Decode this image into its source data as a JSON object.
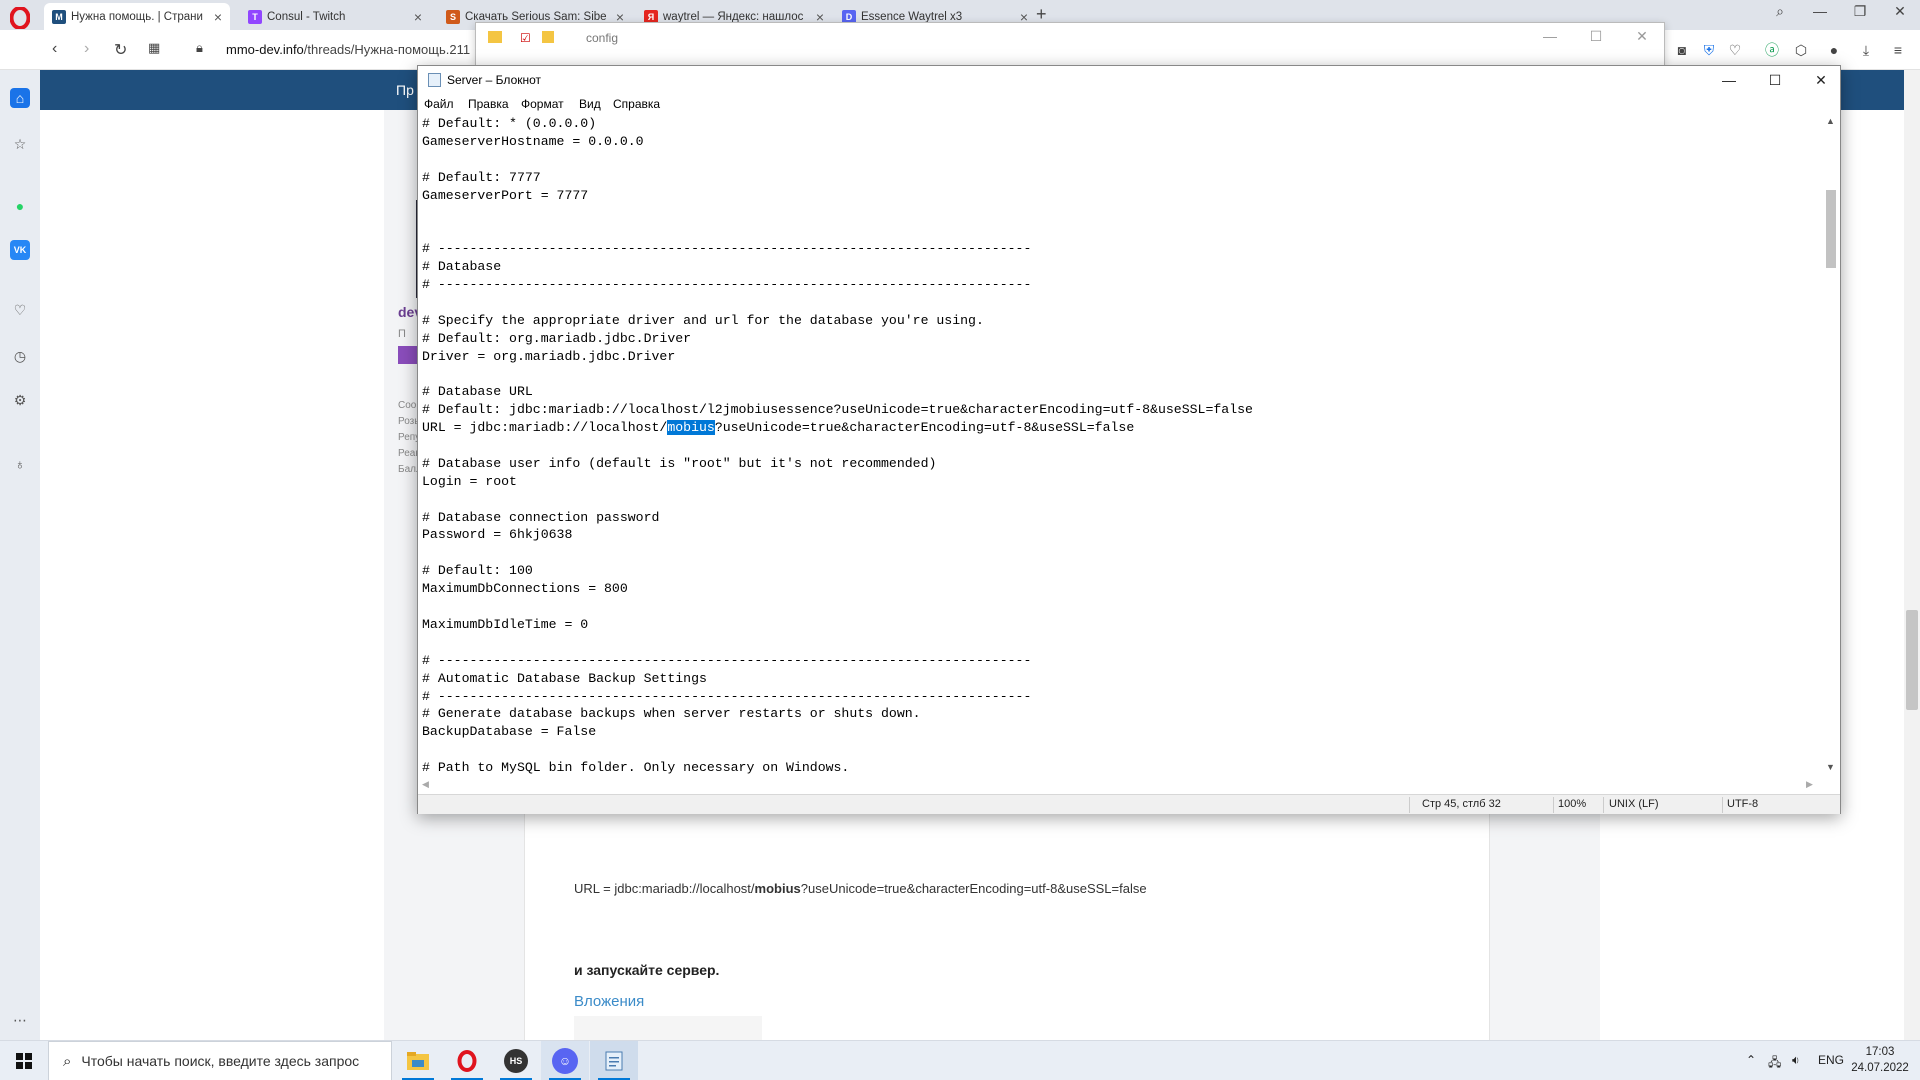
{
  "browser": {
    "tabs": [
      {
        "title": "Нужна помощь. | Страни",
        "icon": "M",
        "icon_color": "#1f4f7d",
        "active": true
      },
      {
        "title": "Consul - Twitch",
        "icon": "T",
        "icon_color": "#9146ff",
        "active": false
      },
      {
        "title": "Скачать Serious Sam: Sibe",
        "icon": "S",
        "icon_color": "#d05a1a",
        "active": false
      },
      {
        "title": "waytrel — Яндекс: нашлос",
        "icon": "Я",
        "icon_color": "#e52620",
        "active": false
      },
      {
        "title": "Essence Waytrel x3",
        "icon": "D",
        "icon_color": "#5865f2",
        "active": false
      }
    ],
    "new_tab": "+",
    "url_host": "mmo-dev.info",
    "url_path": "/threads/Нужна-помощь.211"
  },
  "explorer": {
    "title": "config"
  },
  "webpage": {
    "nav_label": "Пр",
    "user_name": "dev",
    "user_rank": "П",
    "side_labels": [
      "Сооб",
      "Розы",
      "Репу",
      "Реак",
      "Балл"
    ],
    "post_url_prefix": "URL = jdbc:mariadb://localhost/",
    "post_url_bold": "mobius",
    "post_url_suffix": "?useUnicode=true&characterEncoding=utf-8&useSSL=false",
    "post_run_text": "и запускайте сервер.",
    "attachments_label": "Вложения"
  },
  "notepad": {
    "title": "Server – Блокнот",
    "menu": [
      "Файл",
      "Правка",
      "Формат",
      "Вид",
      "Справка"
    ],
    "lines": [
      "# Default: * (0.0.0.0)",
      "GameserverHostname = 0.0.0.0",
      "",
      "# Default: 7777",
      "GameserverPort = 7777",
      "",
      "",
      "# ---------------------------------------------------------------------------",
      "# Database",
      "# ---------------------------------------------------------------------------",
      "",
      "# Specify the appropriate driver and url for the database you're using.",
      "# Default: org.mariadb.jdbc.Driver",
      "Driver = org.mariadb.jdbc.Driver",
      "",
      "# Database URL",
      "# Default: jdbc:mariadb://localhost/l2jmobiusessence?useUnicode=true&characterEncoding=utf-8&useSSL=false",
      "URL = jdbc:mariadb://localhost/mobius?useUnicode=true&characterEncoding=utf-8&useSSL=false",
      "",
      "# Database user info (default is \"root\" but it's not recommended)",
      "Login = root",
      "",
      "# Database connection password",
      "Password = 6hkj0638",
      "",
      "# Default: 100",
      "MaximumDbConnections = 800",
      "",
      "MaximumDbIdleTime = 0",
      "",
      "# ---------------------------------------------------------------------------",
      "# Automatic Database Backup Settings",
      "# ---------------------------------------------------------------------------",
      "# Generate database backups when server restarts or shuts down.",
      "BackupDatabase = False",
      "",
      "# Path to MySQL bin folder. Only necessary on Windows."
    ],
    "selected_word": "mobius",
    "selected_line_index": 17,
    "status": {
      "position": "Стр 45, стлб 32",
      "zoom": "100%",
      "line_ending": "UNIX (LF)",
      "encoding": "UTF-8"
    }
  },
  "taskbar": {
    "search_placeholder": "Чтобы начать поиск, введите здесь запрос",
    "apps": [
      "file-explorer",
      "opera",
      "hs",
      "discord",
      "notepad"
    ],
    "tray_lang": "ENG",
    "time": "17:03",
    "date": "24.07.2022"
  },
  "colors": {
    "selection": "#0078d7",
    "site_nav": "#1f4f7d",
    "link": "#3b8bc8"
  }
}
